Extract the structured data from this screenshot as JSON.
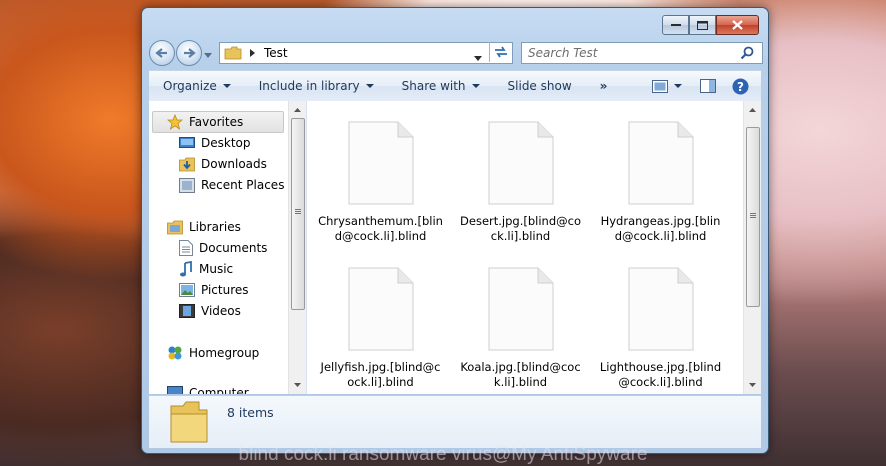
{
  "watermark": "blind cock.li ransomware virus@My AntiSpyware",
  "window": {
    "title": ""
  },
  "nav": {
    "path_segment": "Test",
    "search_placeholder": "Search Test"
  },
  "toolbar": {
    "organize": "Organize",
    "include_in_library": "Include in library",
    "share_with": "Share with",
    "slide_show": "Slide show",
    "more": "»"
  },
  "navpane": {
    "favorites": "Favorites",
    "desktop": "Desktop",
    "downloads": "Downloads",
    "recent_places": "Recent Places",
    "libraries": "Libraries",
    "documents": "Documents",
    "music": "Music",
    "pictures": "Pictures",
    "videos": "Videos",
    "homegroup": "Homegroup",
    "computer": "Computer"
  },
  "files": [
    {
      "name": "Chrysanthemum.[blind@cock.li].blind"
    },
    {
      "name": "Desert.jpg.[blind@cock.li].blind"
    },
    {
      "name": "Hydrangeas.jpg.[blind@cock.li].blind"
    },
    {
      "name": "Jellyfish.jpg.[blind@cock.li].blind"
    },
    {
      "name": "Koala.jpg.[blind@cock.li].blind"
    },
    {
      "name": "Lighthouse.jpg.[blind@cock.li].blind"
    }
  ],
  "details": {
    "count": "8 items"
  },
  "colors": {
    "accent": "#1e395b",
    "close": "#c1402a",
    "window_frame": "#b6cfea"
  }
}
